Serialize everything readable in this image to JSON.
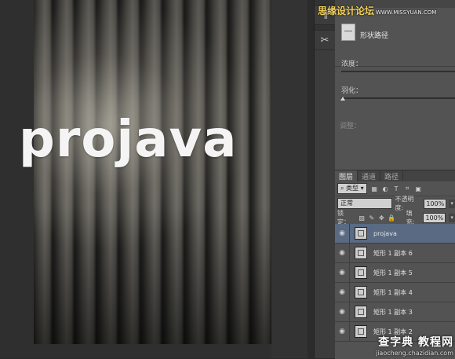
{
  "canvas": {
    "artwork_text": "projava"
  },
  "watermark_top": {
    "brand": "思缘设计论坛",
    "url": "WWW.MISSYUAN.COM"
  },
  "watermark_bottom": {
    "main": "查字典 教程网",
    "sub": "jiaocheng.chazidian.com"
  },
  "tools": {
    "paragraph_icon": "¶",
    "scissors_icon": "✂"
  },
  "properties": {
    "shape_label": "形状路径",
    "density_label": "浓度：",
    "feather_label": "羽化：",
    "adjust_label": "调整："
  },
  "layers_panel": {
    "tabs": [
      "图层",
      "通道",
      "路径"
    ],
    "filter_type": "类型",
    "blend_mode": "正常",
    "opacity_label": "不透明度:",
    "opacity_value": "100%",
    "lock_label": "锁定：",
    "fill_label": "填充:",
    "fill_value": "100%",
    "layers": [
      {
        "name": "projava",
        "selected": true
      },
      {
        "name": "矩形 1 副本 6"
      },
      {
        "name": "矩形 1 副本 5"
      },
      {
        "name": "矩形 1 副本 4"
      },
      {
        "name": "矩形 1 副本 3"
      },
      {
        "name": "矩形 1 副本 2"
      }
    ]
  },
  "colors": {
    "selected_layer": "#596a82",
    "panel_bg": "#535353",
    "watermark_accent": "#f2d15a"
  }
}
